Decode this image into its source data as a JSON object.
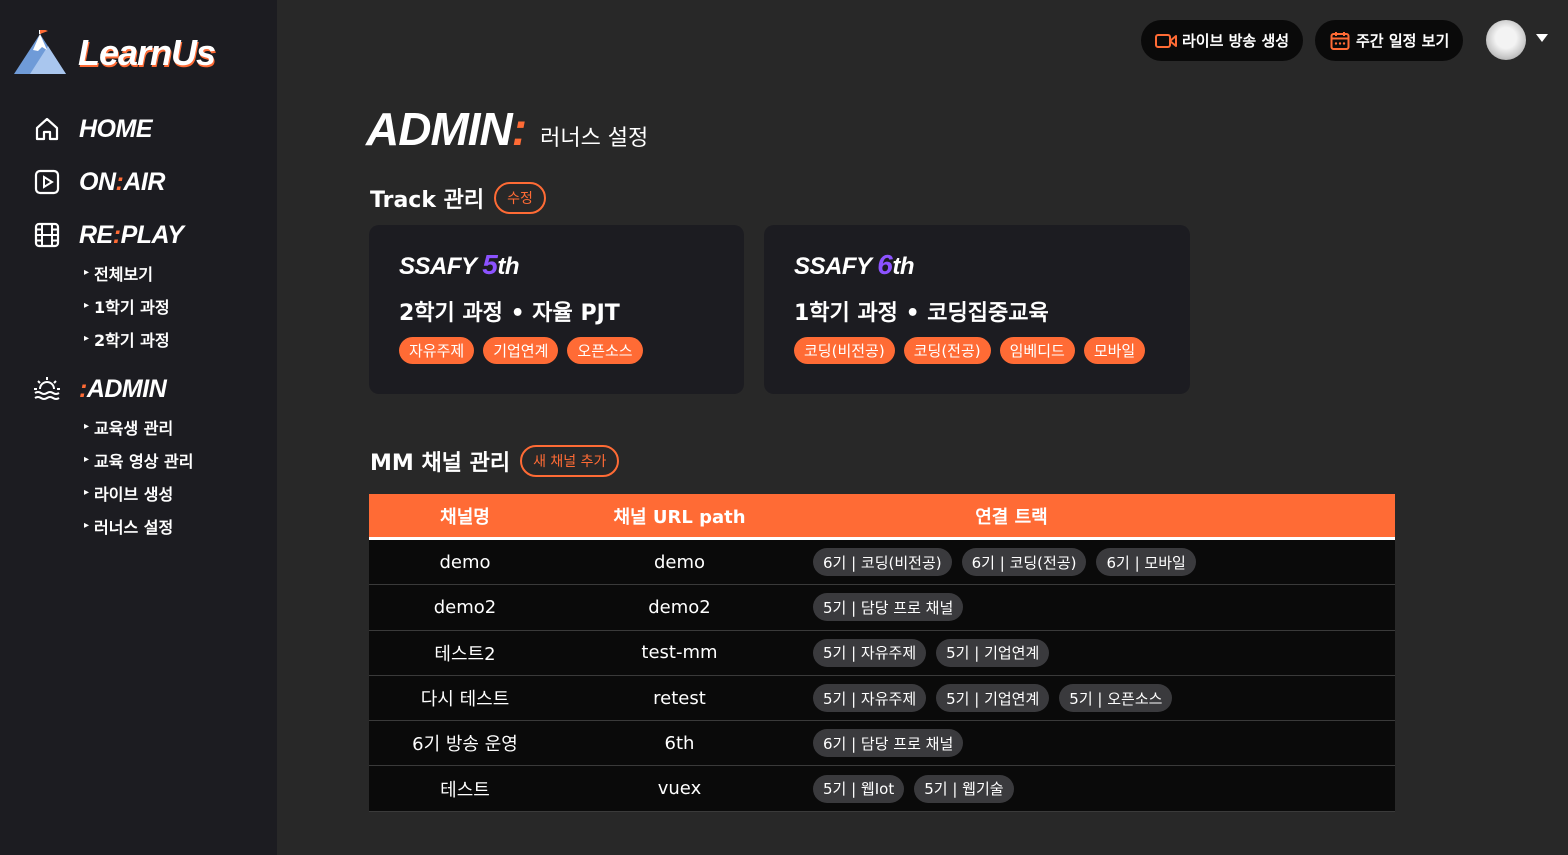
{
  "app": {
    "logo_text": "LearnUs"
  },
  "sidebar": {
    "home": "HOME",
    "onair": {
      "a": "ON",
      "colon": ":",
      "b": "AIR"
    },
    "replay": {
      "a": "RE",
      "colon": ":",
      "b": "PLAY",
      "items": [
        "전체보기",
        "1학기 과정",
        "2학기 과정"
      ]
    },
    "admin": {
      "colon": ":",
      "b": "ADMIN",
      "items": [
        "교육생 관리",
        "교육 영상 관리",
        "라이브 생성",
        "러너스 설정"
      ]
    }
  },
  "topbar": {
    "live_button": "라이브 방송 생성",
    "schedule_button": "주간 일정 보기"
  },
  "page": {
    "title_word": "ADMIN",
    "title_colon": ":",
    "title_sub": "러너스 설정"
  },
  "track_section": {
    "title": "Track 관리",
    "edit_button": "수정"
  },
  "tracks": [
    {
      "brand": "SSAFY",
      "num": "5",
      "suffix": "th",
      "title": "2학기 과정 • 자율 PJT",
      "tags": [
        "자유주제",
        "기업연계",
        "오픈소스"
      ]
    },
    {
      "brand": "SSAFY",
      "num": "6",
      "suffix": "th",
      "title": "1학기 과정 • 코딩집중교육",
      "tags": [
        "코딩(비전공)",
        "코딩(전공)",
        "임베디드",
        "모바일"
      ]
    }
  ],
  "mm_section": {
    "title": "MM 채널 관리",
    "add_button": "새 채널 추가"
  },
  "table": {
    "headers": [
      "채널명",
      "채널 URL path",
      "연결 트랙"
    ],
    "rows": [
      {
        "name": "demo",
        "path": "demo",
        "tracks": [
          "6기 | 코딩(비전공)",
          "6기 | 코딩(전공)",
          "6기 | 모바일"
        ]
      },
      {
        "name": "demo2",
        "path": "demo2",
        "tracks": [
          "5기 | 담당 프로 채널"
        ]
      },
      {
        "name": "테스트2",
        "path": "test-mm",
        "tracks": [
          "5기 | 자유주제",
          "5기 | 기업연계"
        ]
      },
      {
        "name": "다시 테스트",
        "path": "retest",
        "tracks": [
          "5기 | 자유주제",
          "5기 | 기업연계",
          "5기 | 오픈소스"
        ]
      },
      {
        "name": "6기 방송 운영",
        "path": "6th",
        "tracks": [
          "6기 | 담당 프로 채널"
        ]
      },
      {
        "name": "테스트",
        "path": "vuex",
        "tracks": [
          "5기 | 웹Iot",
          "5기 | 웹기술"
        ]
      }
    ]
  },
  "colors": {
    "accent": "#ff6b35",
    "purple": "#8c52ff",
    "sidebar_bg": "#1c1c21",
    "page_bg": "#282828"
  }
}
